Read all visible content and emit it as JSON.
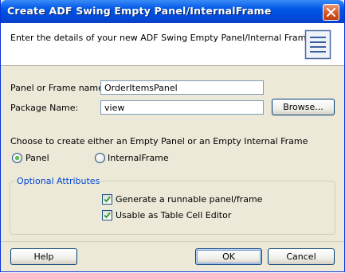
{
  "window": {
    "title": "Create ADF Swing Empty Panel/InternalFrame"
  },
  "header": {
    "text": "Enter the details of your new ADF Swing Empty Panel/Internal Frame"
  },
  "form": {
    "panel_name_label": "Panel or Frame name:",
    "panel_name_value": "OrderItemsPanel",
    "package_label": "Package Name:",
    "package_value": "view",
    "browse_label": "Browse..."
  },
  "choice": {
    "prompt": "Choose to create either an Empty Panel or an Empty Internal Frame",
    "options": [
      {
        "label": "Panel",
        "selected": true
      },
      {
        "label": "InternalFrame",
        "selected": false
      }
    ]
  },
  "optional": {
    "legend": "Optional Attributes",
    "items": [
      {
        "label": "Generate a runnable panel/frame",
        "checked": true
      },
      {
        "label": "Usable as Table Cell Editor",
        "checked": true
      }
    ]
  },
  "buttons": {
    "help": "Help",
    "ok": "OK",
    "cancel": "Cancel"
  },
  "colors": {
    "accent": "#0055e5",
    "group_title": "#0046d5",
    "close": "#d4501c"
  }
}
